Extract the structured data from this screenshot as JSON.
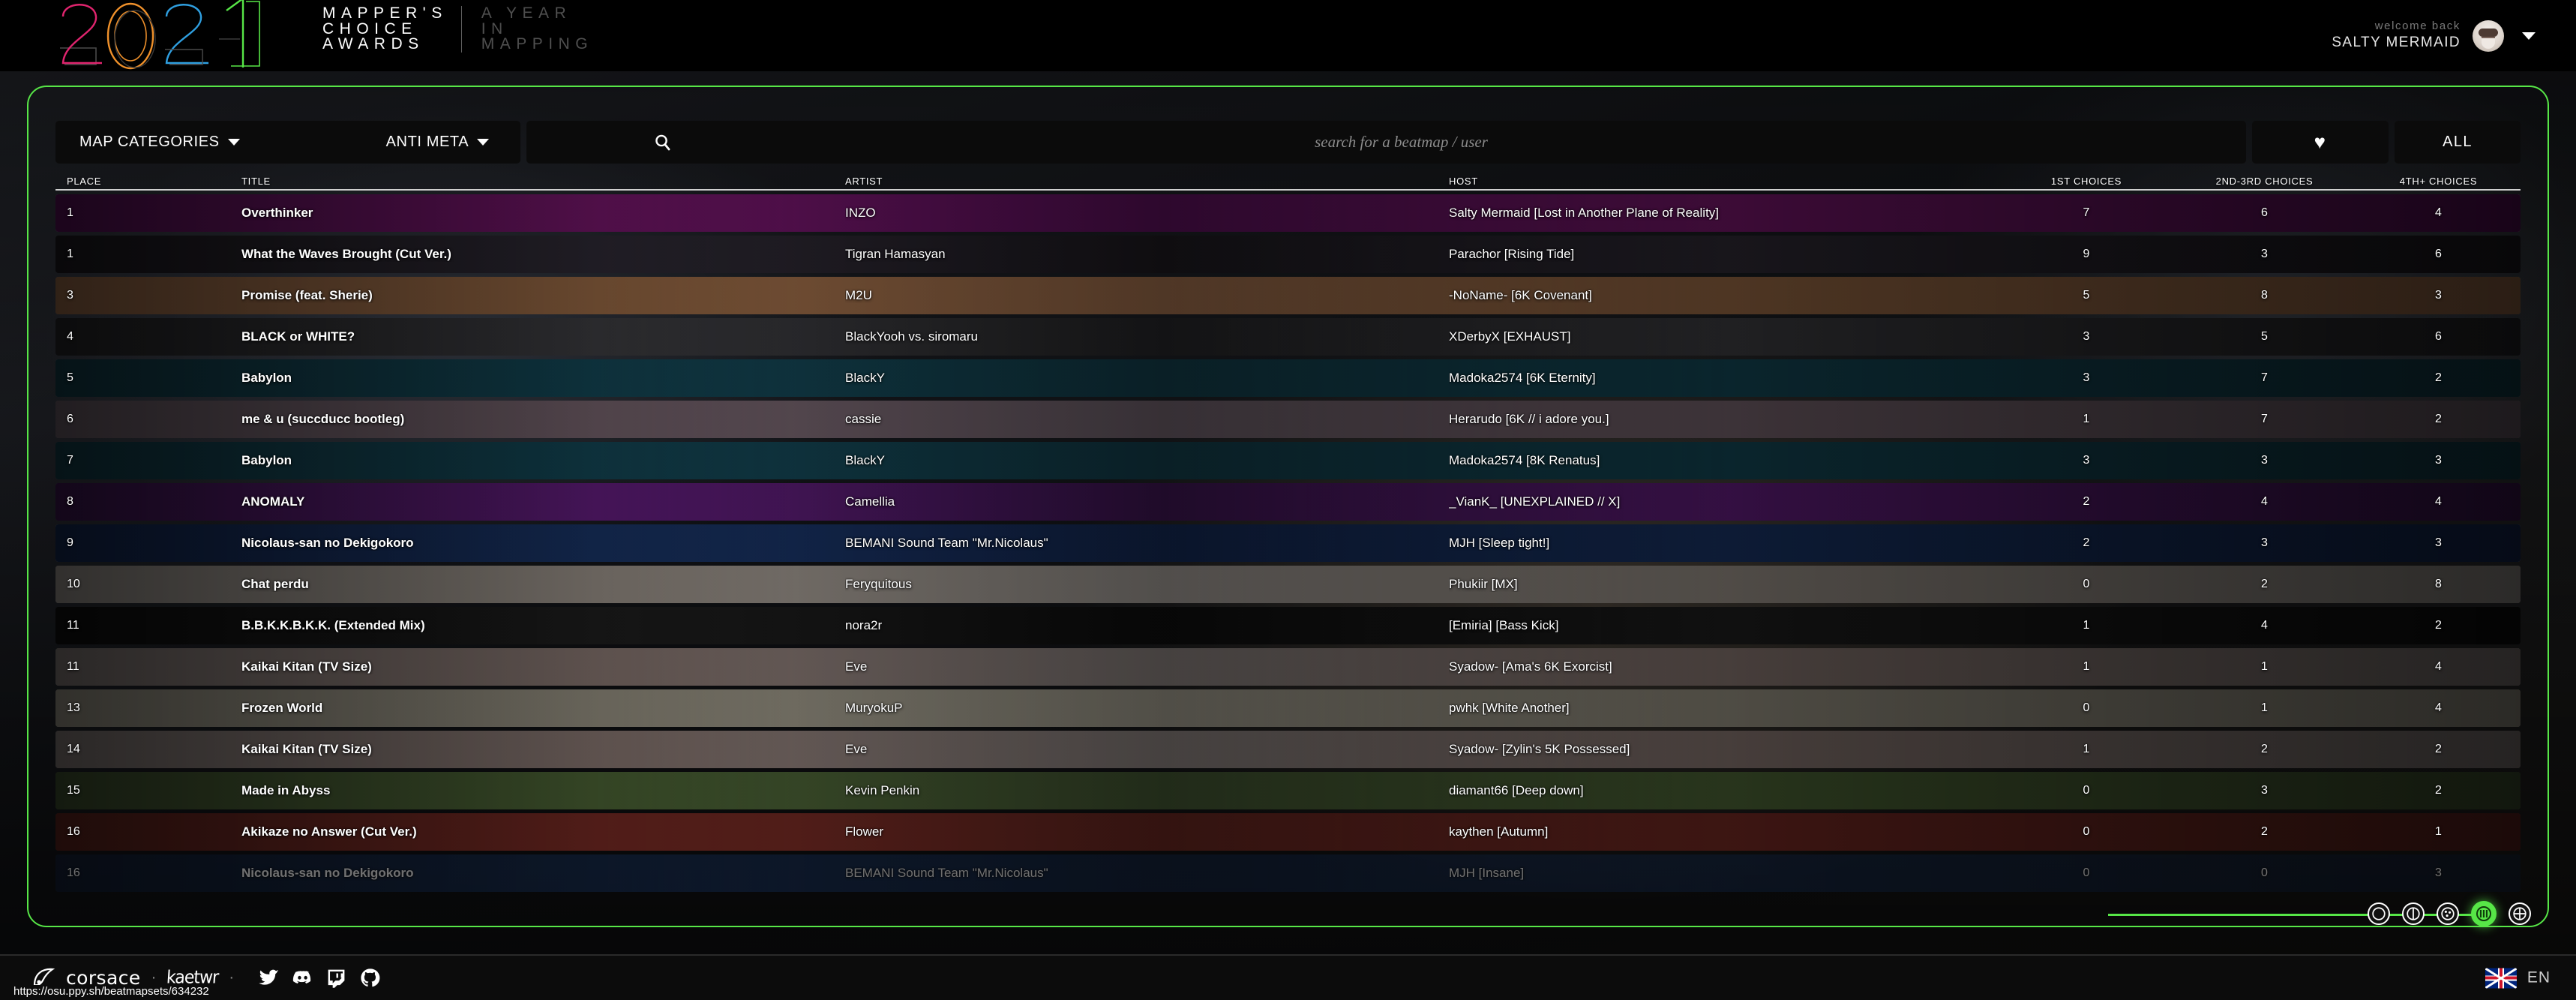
{
  "header": {
    "year_logo": "2021",
    "title": "MAPPER'S\nCHOICE\nAWARDS",
    "subtitle": "A YEAR\nIN\nMAPPING",
    "welcome_label": "welcome back",
    "username": "SALTY MERMAID"
  },
  "toolbar": {
    "map_categories": "MAP CATEGORIES",
    "anti_meta": "ANTI META",
    "search_placeholder": "search for a beatmap / user",
    "search_value": "",
    "favourites_label": "♥",
    "all_label": "ALL"
  },
  "table": {
    "columns": [
      "PLACE",
      "TITLE",
      "ARTIST",
      "HOST",
      "1ST CHOICES",
      "2ND-3RD CHOICES",
      "4TH+ CHOICES"
    ],
    "rows": [
      {
        "place": "1",
        "title": "Overthinker",
        "artist": "INZO",
        "host": "Salty Mermaid [Lost in Another Plane of Reality]",
        "c1": "7",
        "c2": "6",
        "c3": "4",
        "bg": "#3d0b3d",
        "accent": "#6a1460",
        "faded": false,
        "highlight": true
      },
      {
        "place": "1",
        "title": "What the Waves Brought (Cut Ver.)",
        "artist": "Tigran Hamasyan",
        "host": "Parachor [Rising Tide]",
        "c1": "9",
        "c2": "3",
        "c3": "6",
        "bg": "#141216",
        "accent": "#2a2630",
        "faded": false,
        "highlight": false
      },
      {
        "place": "3",
        "title": "Promise (feat. Sherie)",
        "artist": "M2U",
        "host": "-NoName- [6K Covenant]",
        "c1": "5",
        "c2": "8",
        "c3": "3",
        "bg": "#6b4a33",
        "accent": "#8a5f3e",
        "faded": false,
        "highlight": false
      },
      {
        "place": "4",
        "title": "BLACK or WHITE?",
        "artist": "BlackYooh vs. siromaru",
        "host": "XDerbyX [EXHAUST]",
        "c1": "3",
        "c2": "5",
        "c3": "6",
        "bg": "#1a1a1c",
        "accent": "#38383c",
        "faded": false,
        "highlight": false
      },
      {
        "place": "5",
        "title": "Babylon",
        "artist": "BlackY",
        "host": "Madoka2574 [6K Eternity]",
        "c1": "3",
        "c2": "7",
        "c3": "2",
        "bg": "#0d2a33",
        "accent": "#12414f",
        "faded": false,
        "highlight": false
      },
      {
        "place": "6",
        "title": "me & u (succducc bootleg)",
        "artist": "cassie",
        "host": "Herarudo [6K // i adore you.]",
        "c1": "1",
        "c2": "7",
        "c3": "2",
        "bg": "#4a4148",
        "accent": "#6b5a63",
        "faded": false,
        "highlight": false
      },
      {
        "place": "7",
        "title": "Babylon",
        "artist": "BlackY",
        "host": "Madoka2574 [8K Renatus]",
        "c1": "3",
        "c2": "3",
        "c3": "3",
        "bg": "#0d2a33",
        "accent": "#12414f",
        "faded": false,
        "highlight": false
      },
      {
        "place": "8",
        "title": "ANOMALY",
        "artist": "Camellia",
        "host": "_VianK_ [UNEXPLAINED // X]",
        "c1": "2",
        "c2": "4",
        "c3": "4",
        "bg": "#2a0f38",
        "accent": "#5b1b74",
        "faded": false,
        "highlight": false
      },
      {
        "place": "9",
        "title": "Nicolaus-san no Dekigokoro",
        "artist": "BEMANI Sound Team \"Mr.Nicolaus\"",
        "host": "MJH [Sleep tight!]",
        "c1": "2",
        "c2": "3",
        "c3": "3",
        "bg": "#0e1c3a",
        "accent": "#17305e",
        "faded": false,
        "highlight": true
      },
      {
        "place": "10",
        "title": "Chat perdu",
        "artist": "Feryquitous",
        "host": "Phukiir [MX]",
        "c1": "0",
        "c2": "2",
        "c3": "8",
        "bg": "#6e6a66",
        "accent": "#8d857d",
        "faded": false,
        "highlight": false
      },
      {
        "place": "11",
        "title": "B.B.K.K.B.K.K. (Extended Mix)",
        "artist": "nora2r",
        "host": "[Emiria] [Bass Kick]",
        "c1": "1",
        "c2": "4",
        "c3": "2",
        "bg": "#0a0a0a",
        "accent": "#1c1c1c",
        "faded": false,
        "highlight": false
      },
      {
        "place": "11",
        "title": "Kaikai Kitan (TV Size)",
        "artist": "Eve",
        "host": "Syadow- [Ama's 6K Exorcist]",
        "c1": "1",
        "c2": "1",
        "c3": "4",
        "bg": "#5e5856",
        "accent": "#7d6d68",
        "faded": false,
        "highlight": false
      },
      {
        "place": "13",
        "title": "Frozen World",
        "artist": "MuryokuP",
        "host": "pwhk [White Another]",
        "c1": "0",
        "c2": "1",
        "c3": "4",
        "bg": "#6d6a60",
        "accent": "#8b8678",
        "faded": false,
        "highlight": false
      },
      {
        "place": "14",
        "title": "Kaikai Kitan (TV Size)",
        "artist": "Eve",
        "host": "Syadow- [Zylin's 5K Possessed]",
        "c1": "1",
        "c2": "2",
        "c3": "2",
        "bg": "#5e5856",
        "accent": "#7d6d68",
        "faded": false,
        "highlight": false
      },
      {
        "place": "15",
        "title": "Made in Abyss",
        "artist": "Kevin Penkin",
        "host": "diamant66 [Deep down]",
        "c1": "0",
        "c2": "3",
        "c3": "2",
        "bg": "#2d3a22",
        "accent": "#465c31",
        "faded": false,
        "highlight": false
      },
      {
        "place": "16",
        "title": "Akikaze no Answer (Cut Ver.)",
        "artist": "Flower",
        "host": "kaythen [Autumn]",
        "c1": "0",
        "c2": "2",
        "c3": "1",
        "bg": "#451a16",
        "accent": "#6b2620",
        "faded": false,
        "highlight": false
      },
      {
        "place": "16",
        "title": "Nicolaus-san no Dekigokoro",
        "artist": "BEMANI Sound Team \"Mr.Nicolaus\"",
        "host": "MJH [Insane]",
        "c1": "0",
        "c2": "0",
        "c3": "3",
        "bg": "#11264a",
        "accent": "#1a3a6e",
        "faded": true,
        "highlight": false
      }
    ]
  },
  "modes": [
    {
      "name": "osu-standard",
      "active": false
    },
    {
      "name": "osu-taiko",
      "active": false
    },
    {
      "name": "osu-catch",
      "active": false
    },
    {
      "name": "osu-mania",
      "active": true
    },
    {
      "name": "osu-storyboard",
      "active": false
    }
  ],
  "footer": {
    "brand": "corsace",
    "partner": "kaetwr",
    "separator": "·",
    "status_url": "https://osu.ppy.sh/beatmapsets/634232",
    "socials": [
      "twitter-icon",
      "discord-icon",
      "twitch-icon",
      "github-icon"
    ],
    "language": "EN"
  },
  "colors": {
    "accent_green": "#57e647",
    "background": "#0a0a0a",
    "panel_border": "#57e647",
    "text_primary": "#ffffff",
    "text_muted": "#7a7a7a"
  }
}
